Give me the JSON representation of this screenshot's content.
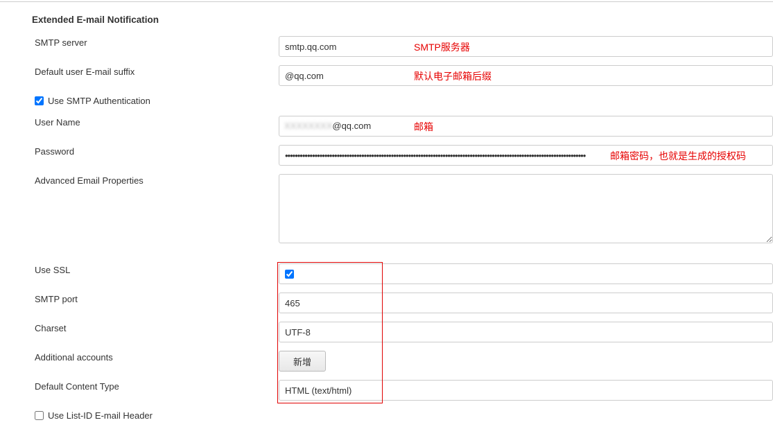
{
  "section_title": "Extended E-mail Notification",
  "labels": {
    "smtp_server": "SMTP server",
    "default_suffix": "Default user E-mail suffix",
    "use_smtp_auth": "Use SMTP Authentication",
    "user_name": "User Name",
    "password": "Password",
    "advanced": "Advanced Email Properties",
    "use_ssl": "Use SSL",
    "smtp_port": "SMTP port",
    "charset": "Charset",
    "additional_accounts": "Additional accounts",
    "default_content_type": "Default Content Type",
    "use_list_id": "Use List-ID E-mail Header"
  },
  "values": {
    "smtp_server": "smtp.qq.com",
    "default_suffix": "@qq.com",
    "user_name_blur": "XXXXXXXX",
    "user_name_suffix": "@qq.com",
    "password": "••••••••••••••••••••••••••••••••••••••••••••••••••••••••••••••••••••••••••••••••••••••••••••••••••••••••••••••••••••••••••",
    "advanced": "",
    "smtp_port": "465",
    "charset": "UTF-8",
    "default_content_type": "HTML (text/html)"
  },
  "buttons": {
    "add": "新增"
  },
  "annotations": {
    "smtp_server": "SMTP服务器",
    "default_suffix": "默认电子邮箱后缀",
    "user_name": "邮箱",
    "password": "邮箱密码，也就是生成的授权码"
  },
  "checks": {
    "use_smtp_auth": true,
    "use_ssl": true,
    "use_list_id": false
  }
}
